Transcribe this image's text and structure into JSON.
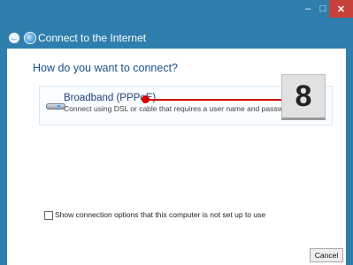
{
  "window": {
    "title": "Connect to the Internet",
    "minimize_glyph": "–",
    "maximize_glyph": "□",
    "close_glyph": "✕"
  },
  "header": {
    "back_icon": "back-arrow-icon",
    "back_glyph": "←",
    "globe_icon": "globe-icon"
  },
  "main": {
    "question": "How do you want to connect?",
    "option": {
      "title": "Broadband (PPPoE)",
      "description": "Connect using DSL or cable that requires a user name and password.",
      "icon": "modem-icon"
    },
    "annotation": {
      "number": "8",
      "line_color": "#d40000"
    },
    "checkbox": {
      "label": "Show connection options that this computer is not set up to use",
      "checked": false
    },
    "buttons": {
      "cancel": "Cancel"
    }
  },
  "colors": {
    "frame": "#2e7fae",
    "close_button": "#c7413b",
    "question_text": "#1a4f8a"
  }
}
